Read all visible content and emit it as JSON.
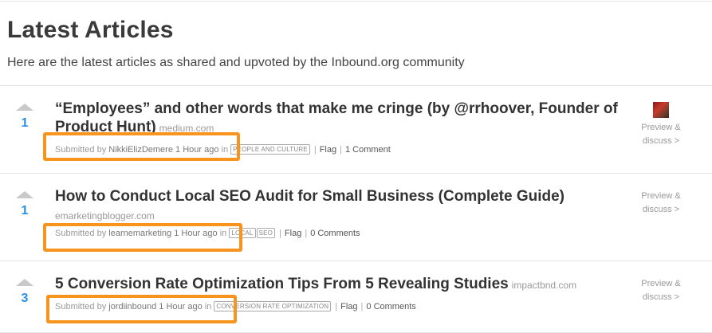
{
  "header": {
    "title": "Latest Articles",
    "subtitle": "Here are the latest articles as shared and upvoted by the Inbound.org community"
  },
  "articles": [
    {
      "votes": "1",
      "title": "“Employees” and other words that make me cringe (by @rrhoover, Founder of Product Hunt)",
      "domain": "medium.com",
      "submitted_prefix": "Submitted by",
      "user": "NikkiElizDemere",
      "time": "1 Hour ago",
      "in": "in",
      "tags": [
        "PEOPLE AND CULTURE"
      ],
      "flag": "Flag",
      "comments": "1 Comment",
      "preview_line1": "Preview &",
      "preview_line2": "discuss >",
      "has_avatar": true
    },
    {
      "votes": "1",
      "title": "How to Conduct Local SEO Audit for Small Business (Complete Guide)",
      "domain": "emarketingblogger.com",
      "submitted_prefix": "Submitted by",
      "user": "learnemarketing",
      "time": "1 Hour ago",
      "in": "in",
      "tags": [
        "LOCAL",
        "SEO"
      ],
      "flag": "Flag",
      "comments": "0 Comments",
      "preview_line1": "Preview &",
      "preview_line2": "discuss >",
      "has_avatar": false
    },
    {
      "votes": "3",
      "title": "5 Conversion Rate Optimization Tips From 5 Revealing Studies",
      "domain": "impactbnd.com",
      "submitted_prefix": "Submitted by",
      "user": "jordiinbound",
      "time": "1 Hour ago",
      "in": "in",
      "tags": [
        "CONVERSION RATE OPTIMIZATION"
      ],
      "flag": "Flag",
      "comments": "0 Comments",
      "preview_line1": "Preview &",
      "preview_line2": "discuss >",
      "has_avatar": false
    }
  ],
  "colors": {
    "highlight": "#f7941d",
    "vote_count": "#2a8fe0"
  }
}
